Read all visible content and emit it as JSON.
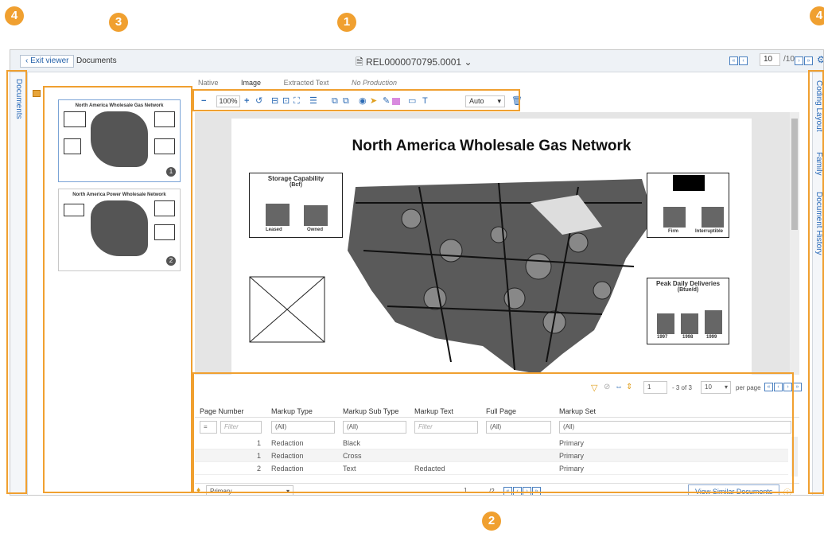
{
  "callouts": [
    "1",
    "2",
    "3",
    "4",
    "4"
  ],
  "topbar": {
    "exit_label": "Exit viewer",
    "breadcrumb": "Documents",
    "doc_title": "REL0000070795.0001",
    "page_current": "10",
    "page_total": "/10"
  },
  "left_panel_label": "Documents",
  "right_panel": {
    "items": [
      "Coding Layout",
      "Family",
      "Document History"
    ]
  },
  "tabs": [
    "Native",
    "Image",
    "Extracted Text",
    "No Production"
  ],
  "toolbar": {
    "zoom": "100%",
    "fit_mode": "Auto"
  },
  "thumbnails": [
    {
      "title": "North America Wholesale Gas Network",
      "number": "1"
    },
    {
      "title": "North America Power Wholesale Network",
      "number": "2"
    }
  ],
  "document": {
    "title": "North America Wholesale Gas Network",
    "storage_title": "Storage Capability",
    "storage_unit": "(Bcf)",
    "storage_labels": [
      "Leased",
      "Owned"
    ],
    "firm_labels": [
      "Firm",
      "Interruptible"
    ],
    "peak_title": "Peak Daily Deliveries",
    "peak_unit": "(Btue/d)",
    "peak_labels": [
      "1997",
      "1998",
      "1999"
    ]
  },
  "markup_grid": {
    "page_input": "1",
    "count_text": "- 3 of 3",
    "per_page_value": "10",
    "per_page_label": "per page",
    "columns": [
      "Page Number",
      "Markup Type",
      "Markup Sub Type",
      "Markup Text",
      "Full Page",
      "Markup Set"
    ],
    "filters": {
      "page_op": "=",
      "page_placeholder": "Filter",
      "type": "(All)",
      "subtype": "(All)",
      "text_placeholder": "Filter",
      "full_page": "(All)",
      "set": "(All)"
    },
    "rows": [
      {
        "page": "1",
        "type": "Redaction",
        "subtype": "Black",
        "text": "",
        "set": "Primary"
      },
      {
        "page": "1",
        "type": "Redaction",
        "subtype": "Cross",
        "text": "",
        "set": "Primary"
      },
      {
        "page": "2",
        "type": "Redaction",
        "subtype": "Text",
        "text": "Redacted",
        "set": "Primary"
      }
    ]
  },
  "bottom_bar": {
    "markup_set": "Primary",
    "page": "1",
    "page_total": "/2",
    "view_similar": "View Similar Documents"
  }
}
